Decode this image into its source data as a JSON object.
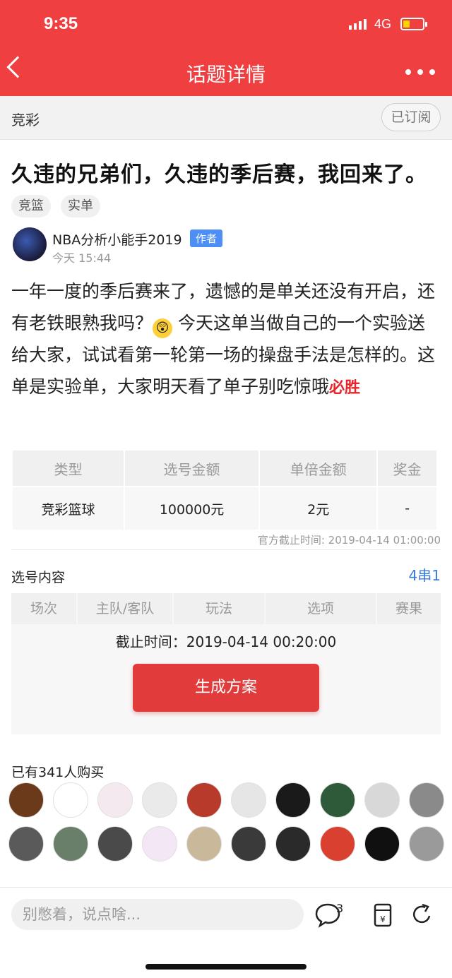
{
  "status": {
    "time": "9:35",
    "network": "4G"
  },
  "nav": {
    "title": "话题详情"
  },
  "channel": {
    "name": "竞彩",
    "subscribe_label": "已订阅"
  },
  "post": {
    "title": "久违的兄弟们，久违的季后赛，我回来了。",
    "tags": [
      "竞篮",
      "实单"
    ],
    "author": {
      "name": "NBA分析小能手2019",
      "badge": "作者",
      "time": "今天 15:44"
    },
    "body_part1": "一年一度的季后赛来了，遗憾的是单关还没有开启，还有老铁眼熟我吗？",
    "body_part2": " 今天这单当做自己的一个实验送给大家，试试看第一轮第一场的操盘手法是怎样的。这单是实验单，大家明天看了单子别吃惊哦",
    "body_highlight": "必胜"
  },
  "plan_table": {
    "headers": [
      "类型",
      "选号金额",
      "单倍金额",
      "奖金"
    ],
    "row": [
      "竞彩篮球",
      "100000元",
      "2元",
      "-"
    ],
    "official_deadline": "官方截止时间: 2019-04-14 01:00:00"
  },
  "selection": {
    "label": "选号内容",
    "type": "4串1",
    "headers": [
      "场次",
      "主队/客队",
      "玩法",
      "选项",
      "赛果"
    ],
    "deadline": "截止时间：2019-04-14 00:20:00",
    "generate_label": "生成方案"
  },
  "buyers": {
    "label": "已有341人购买",
    "avatar_colors": [
      "#6a3a1a",
      "#ffffff",
      "#f4e9ef",
      "#eaeaea",
      "#b73a2a",
      "#e6e6e6",
      "#1a1a1a",
      "#2f5a3a",
      "#d8d8d8",
      "#8a8a8a",
      "#5a5a5a",
      "#6a7f6a",
      "#4a4a4a",
      "#f3e6f5",
      "#c9b89a",
      "#3a3a3a",
      "#2a2a2a",
      "#d9402f",
      "#101010",
      "#9a9a9a"
    ]
  },
  "bottom_bar": {
    "placeholder": "别憋着，说点啥...",
    "comment_count": "3"
  },
  "colors": {
    "brand_red": "#ef3f40",
    "button_red": "#e23b3b",
    "link_blue": "#3b7bd8",
    "badge_blue": "#4d8ff6"
  }
}
